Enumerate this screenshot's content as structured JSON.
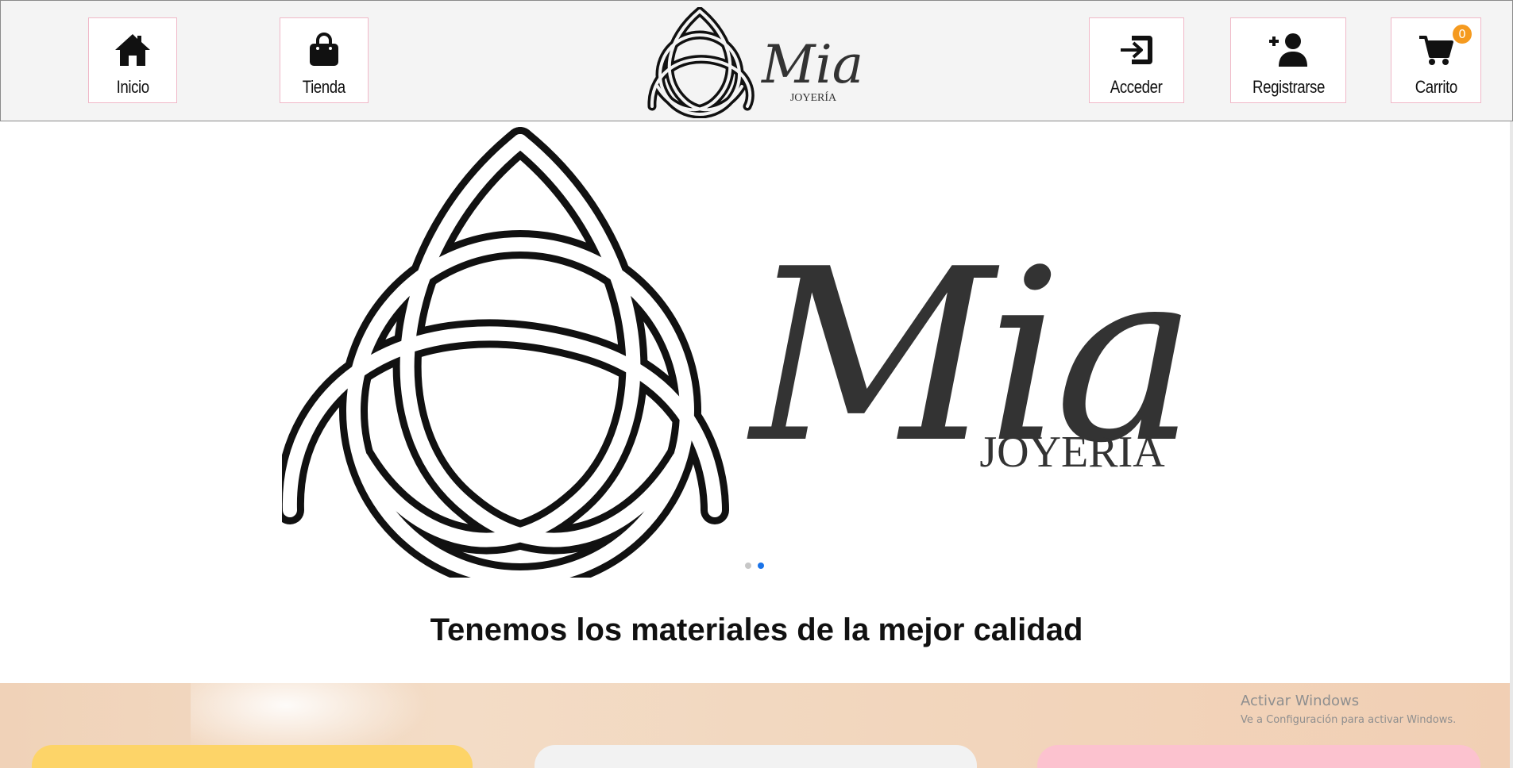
{
  "header": {
    "nav_left": [
      {
        "label": "Inicio",
        "icon": "home-icon"
      },
      {
        "label": "Tienda",
        "icon": "shopping-bag-icon"
      }
    ],
    "nav_right": [
      {
        "label": "Acceder",
        "icon": "login-icon"
      },
      {
        "label": "Registrarse",
        "icon": "add-user-icon"
      },
      {
        "label": "Carrito",
        "icon": "cart-icon",
        "badge": "0"
      }
    ],
    "logo": {
      "name": "Mia",
      "subtitle": "JOYERÍA"
    }
  },
  "hero": {
    "logo": {
      "name": "Mia",
      "subtitle": "JOYERÍA"
    },
    "carousel": {
      "slides": 2,
      "active": 2
    }
  },
  "tagline": "Tenemos los materiales de la mejor calidad",
  "watermark": {
    "title": "Activar Windows",
    "subtitle": "Ve a Configuración para activar Windows."
  },
  "colors": {
    "header_bg": "#f4f4f4",
    "nav_border": "#f0b8c8",
    "badge": "#f59a1f",
    "active_dot": "#1a73e8",
    "card_yellow": "#fdd468",
    "card_grey": "#f2f2f2",
    "card_pink": "#fcc2cf"
  }
}
